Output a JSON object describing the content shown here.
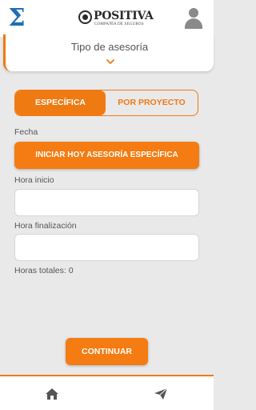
{
  "header": {
    "menu_icon": "sigma-icon",
    "brand_name": "POSITIVA",
    "brand_subtitle": "COMPAÑÍA DE SEGUROS",
    "profile_icon": "user-icon"
  },
  "type_selector": {
    "title": "Tipo de asesoría",
    "chevron_icon": "chevron-down-icon"
  },
  "mode_toggle": {
    "options": [
      "ESPECÍFICA",
      "POR PROYECTO"
    ],
    "selected": "ESPECÍFICA"
  },
  "form": {
    "fecha_label": "Fecha",
    "start_button": "INICIAR HOY ASESORÍA ESPECÍFICA",
    "hora_inicio_label": "Hora inicio",
    "hora_inicio_value": "",
    "hora_fin_label": "Hora finalización",
    "hora_fin_value": "",
    "total_hours": "Horas totales: 0"
  },
  "continue_button": "CONTINUAR",
  "bottom_nav": {
    "items": [
      "home-icon",
      "send-icon"
    ]
  },
  "colors": {
    "accent": "#f07a12",
    "menu_blue": "#1e6fb3",
    "background": "#e9e9e9"
  }
}
